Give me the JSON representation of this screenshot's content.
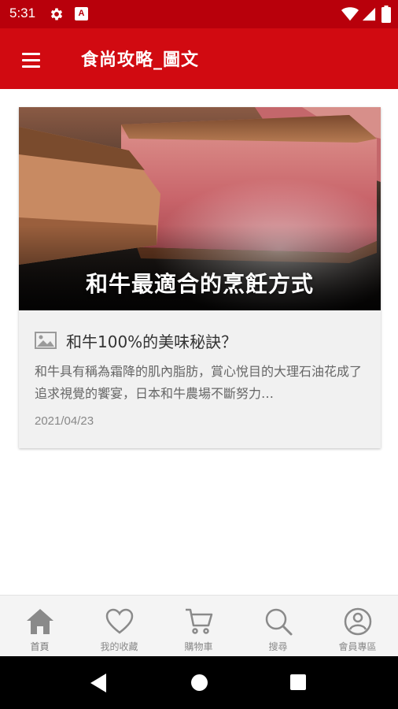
{
  "status_bar": {
    "time": "5:31",
    "icons": [
      "gear-icon",
      "a-badge-icon",
      "wifi-icon",
      "signal-icon",
      "battery-icon"
    ],
    "color": "#b8000b"
  },
  "app_bar": {
    "menu_icon": "hamburger-menu-icon",
    "title": "食尚攻略_圖文",
    "color": "#d10a11"
  },
  "article": {
    "image_caption": "和牛最適合的烹飪方式",
    "type_icon": "image-icon",
    "title": "和牛100%的美味秘訣？",
    "excerpt": "和牛具有稱為霜降的肌內脂肪，賞心悅目的大理石油花成了追求視覺的饗宴，日本和牛農場不斷努力…",
    "date": "2021/04/23"
  },
  "bottom_nav": {
    "items": [
      {
        "label": "首頁",
        "icon": "home-icon",
        "active": true
      },
      {
        "label": "我的收藏",
        "icon": "heart-icon",
        "active": false
      },
      {
        "label": "購物車",
        "icon": "cart-icon",
        "active": false
      },
      {
        "label": "搜尋",
        "icon": "search-icon",
        "active": false
      },
      {
        "label": "會員專區",
        "icon": "user-icon",
        "active": false
      }
    ]
  },
  "system_nav": {
    "icons": [
      "back-icon",
      "home-circle-icon",
      "recents-icon"
    ]
  }
}
